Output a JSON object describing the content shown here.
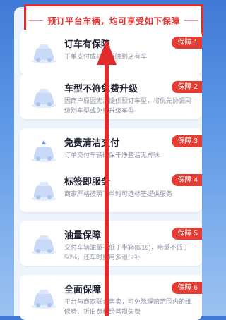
{
  "banner": {
    "text": "预订平台车辆，均可享受如下保障"
  },
  "guarantees": [
    {
      "title": "订车有保障",
      "desc": "下单支付成功即保障到店有车",
      "tag": "保障 1"
    },
    {
      "title": "车型不符免费升级",
      "desc": "因商户原因无法提供预订车型，将优先协调同级别车型或免费升级车型",
      "tag": "保障 2"
    },
    {
      "title": "免费清洁交付",
      "desc": "订单交付车辆确保干净整洁无异味",
      "tag": "保障 3"
    },
    {
      "title": "标签即服务",
      "desc": "商家严格按照下单时可选标签提供服务",
      "tag": "保障 4"
    },
    {
      "title": "油量保障",
      "desc": "交付车辆油量不低于半箱(8/16)，电量不低于50%，还车时费用多退少补",
      "tag": "保障 5"
    },
    {
      "title": "全面保障",
      "desc": "平台与商家联合售卖，可免除理赔范围内的维修费、折旧费和经营损失费",
      "tag": "保障 6"
    }
  ],
  "colors": {
    "accent_red": "#e53c34",
    "bg_blue": "#4a84de",
    "annotation_red": "#e22b2b"
  }
}
